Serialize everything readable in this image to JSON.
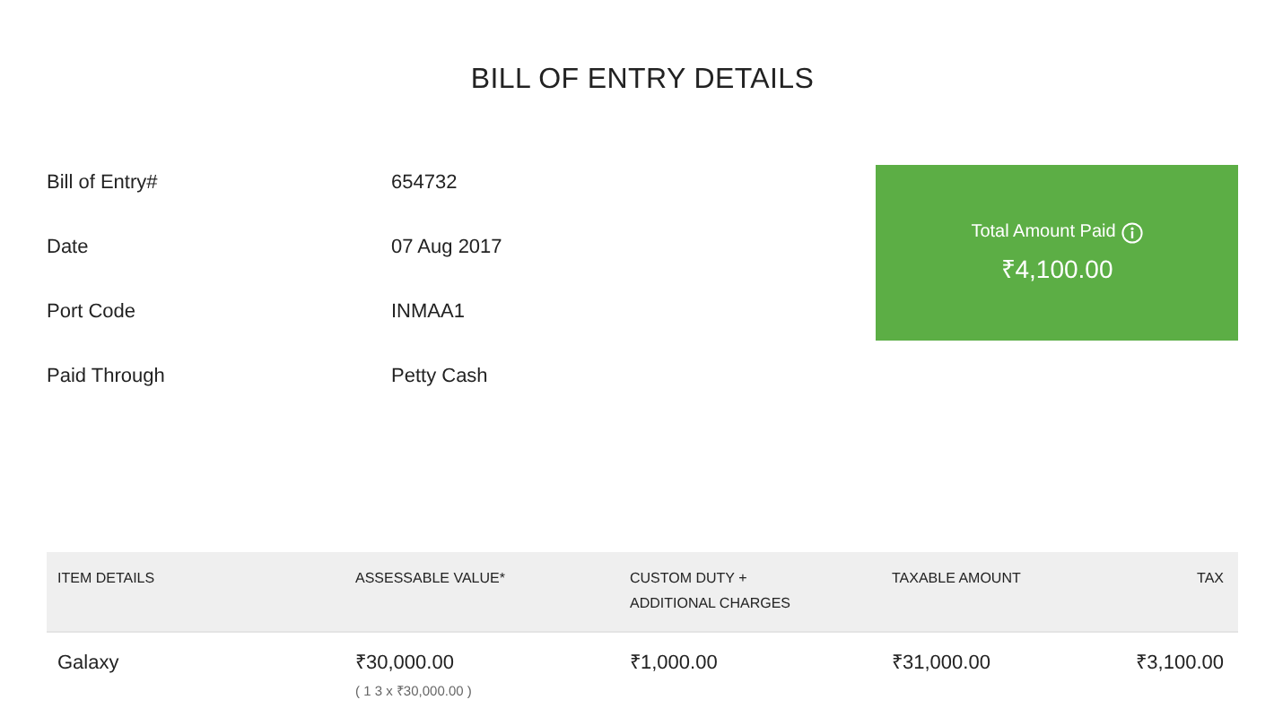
{
  "title": "BILL OF ENTRY DETAILS",
  "details": [
    {
      "label": "Bill of Entry#",
      "value": "654732"
    },
    {
      "label": "Date",
      "value": "07 Aug 2017"
    },
    {
      "label": "Port Code",
      "value": "INMAA1"
    },
    {
      "label": "Paid Through",
      "value": "Petty Cash"
    }
  ],
  "total": {
    "label": "Total Amount Paid",
    "amount": "₹4,100.00"
  },
  "table": {
    "columns": [
      "ITEM DETAILS",
      "ASSESSABLE VALUE*",
      "CUSTOM DUTY + ADDITIONAL CHARGES",
      "TAXABLE AMOUNT",
      "TAX"
    ],
    "rows": [
      {
        "cells": [
          "Galaxy",
          "₹30,000.00",
          "₹1,000.00",
          "₹31,000.00",
          "₹3,100.00"
        ],
        "assessable_note": "( 1 3 x ₹30,000.00 )"
      }
    ]
  }
}
